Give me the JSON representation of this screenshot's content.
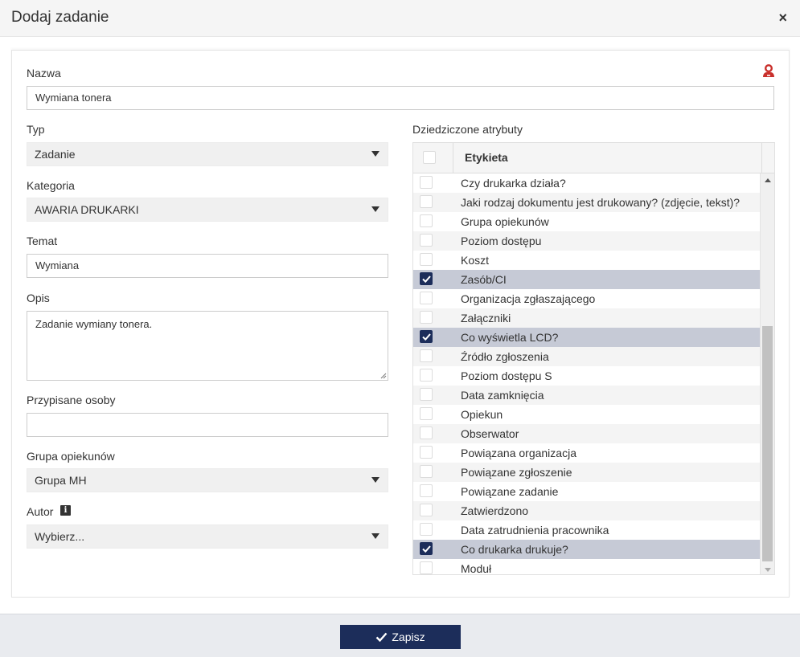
{
  "dialog": {
    "title": "Dodaj zadanie",
    "close_glyph": "×"
  },
  "form": {
    "nazwa": {
      "label": "Nazwa",
      "value": "Wymiana tonera"
    },
    "typ": {
      "label": "Typ",
      "value": "Zadanie"
    },
    "kategoria": {
      "label": "Kategoria",
      "value": "AWARIA DRUKARKI"
    },
    "temat": {
      "label": "Temat",
      "value": "Wymiana"
    },
    "opis": {
      "label": "Opis",
      "value": "Zadanie wymiany tonera."
    },
    "przypisane": {
      "label": "Przypisane osoby",
      "value": ""
    },
    "grupa": {
      "label": "Grupa opiekunów",
      "value": "Grupa MH"
    },
    "autor": {
      "label": "Autor",
      "value": "Wybierz..."
    }
  },
  "attributes": {
    "label": "Dziedziczone atrybuty",
    "column": "Etykieta",
    "rows": [
      {
        "text": "Czy drukarka działa?",
        "checked": false
      },
      {
        "text": "Jaki rodzaj dokumentu jest drukowany? (zdjęcie, tekst)?",
        "checked": false
      },
      {
        "text": "Grupa opiekunów",
        "checked": false
      },
      {
        "text": "Poziom dostępu",
        "checked": false
      },
      {
        "text": "Koszt",
        "checked": false
      },
      {
        "text": "Zasób/CI",
        "checked": true
      },
      {
        "text": "Organizacja zgłaszającego",
        "checked": false
      },
      {
        "text": "Załączniki",
        "checked": false
      },
      {
        "text": "Co wyświetla LCD?",
        "checked": true
      },
      {
        "text": "Źródło zgłoszenia",
        "checked": false
      },
      {
        "text": "Poziom dostępu S",
        "checked": false
      },
      {
        "text": "Data zamknięcia",
        "checked": false
      },
      {
        "text": "Opiekun",
        "checked": false
      },
      {
        "text": "Obserwator",
        "checked": false
      },
      {
        "text": "Powiązana organizacja",
        "checked": false
      },
      {
        "text": "Powiązane zgłoszenie",
        "checked": false
      },
      {
        "text": "Powiązane zadanie",
        "checked": false
      },
      {
        "text": "Zatwierdzono",
        "checked": false
      },
      {
        "text": "Data zatrudnienia pracownika",
        "checked": false
      },
      {
        "text": "Co drukarka drukuje?",
        "checked": true
      },
      {
        "text": "Moduł",
        "checked": false
      }
    ]
  },
  "footer": {
    "save_label": "Zapisz"
  },
  "colors": {
    "primary": "#1c2d5a",
    "selected_row": "#c6cad6",
    "alert_icon": "#c9302c"
  }
}
